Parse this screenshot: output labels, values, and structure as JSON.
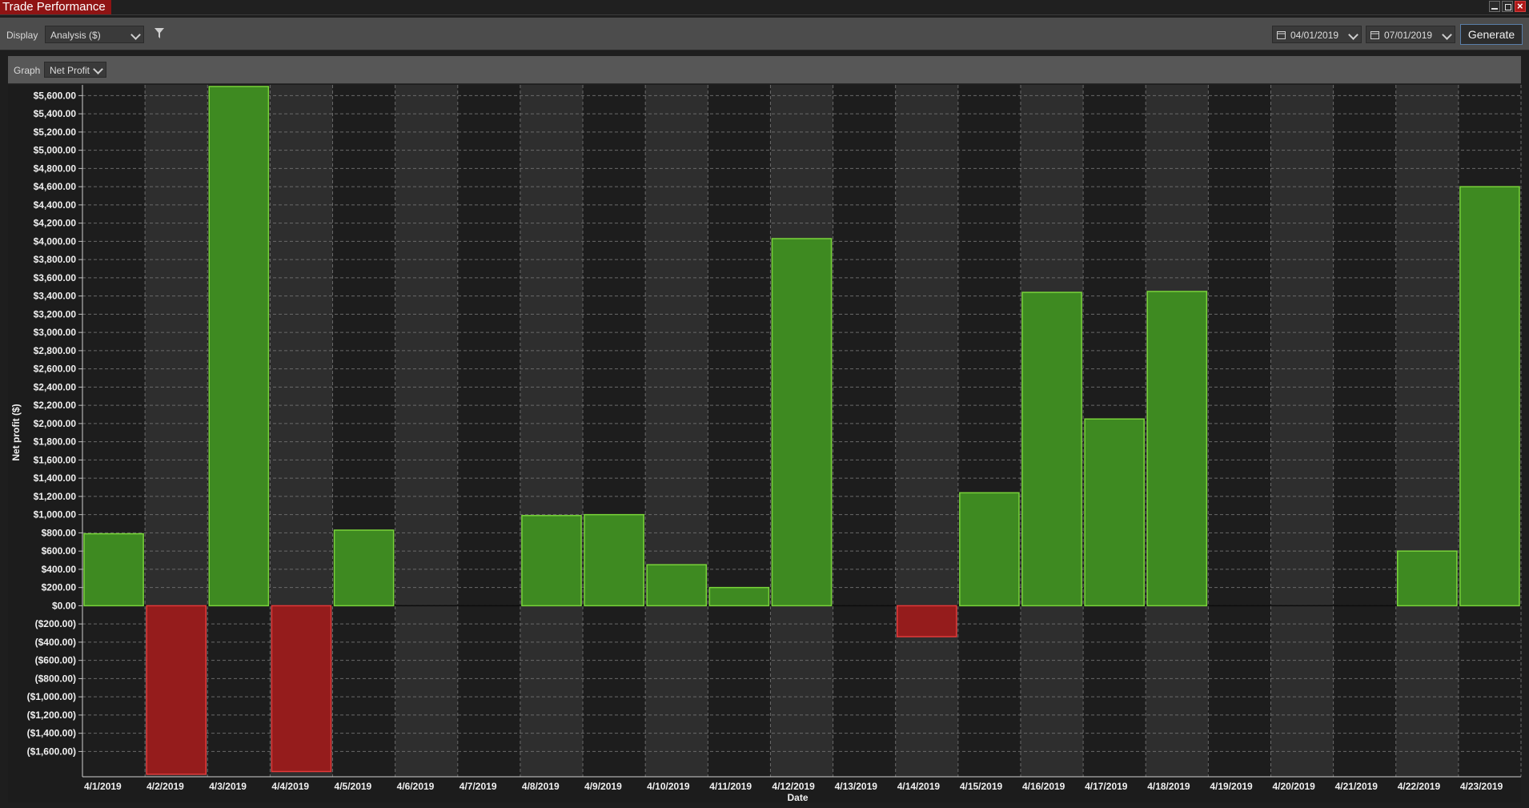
{
  "window": {
    "title": "Trade Performance"
  },
  "toolbar": {
    "display_label": "Display",
    "display_value": "Analysis ($)",
    "start_date": "04/01/2019",
    "end_date": "07/01/2019",
    "generate_label": "Generate"
  },
  "graphbar": {
    "graph_label": "Graph",
    "graph_value": "Net Profit"
  },
  "colors": {
    "positive_fill": "#3e8a21",
    "positive_stroke": "#79d33a",
    "negative_fill": "#951c1c",
    "negative_stroke": "#e23a3a",
    "band_dark": "#1d1d1d",
    "band_light": "#2e2e2e"
  },
  "chart_data": {
    "type": "bar",
    "xlabel": "Date",
    "ylabel": "Net profit ($)",
    "ylim": [
      -1860,
      5700
    ],
    "grid": true,
    "categories": [
      "4/1/2019",
      "4/2/2019",
      "4/3/2019",
      "4/4/2019",
      "4/5/2019",
      "4/6/2019",
      "4/7/2019",
      "4/8/2019",
      "4/9/2019",
      "4/10/2019",
      "4/11/2019",
      "4/12/2019",
      "4/13/2019",
      "4/14/2019",
      "4/15/2019",
      "4/16/2019",
      "4/17/2019",
      "4/18/2019",
      "4/19/2019",
      "4/20/2019",
      "4/21/2019",
      "4/22/2019",
      "4/23/2019"
    ],
    "values": [
      790,
      -1850,
      5700,
      -1820,
      830,
      0,
      0,
      990,
      1000,
      450,
      200,
      4030,
      0,
      -340,
      1240,
      3440,
      2050,
      3450,
      0,
      0,
      0,
      600,
      4600
    ],
    "yticks": [
      5600,
      5400,
      5200,
      5000,
      4800,
      4600,
      4400,
      4200,
      4000,
      3800,
      3600,
      3400,
      3200,
      3000,
      2800,
      2600,
      2400,
      2200,
      2000,
      1800,
      1600,
      1400,
      1200,
      1000,
      800,
      600,
      400,
      200,
      0,
      -200,
      -400,
      -600,
      -800,
      -1000,
      -1200,
      -1400,
      -1600
    ],
    "ytick_labels": [
      "$5,600.00",
      "$5,400.00",
      "$5,200.00",
      "$5,000.00",
      "$4,800.00",
      "$4,600.00",
      "$4,400.00",
      "$4,200.00",
      "$4,000.00",
      "$3,800.00",
      "$3,600.00",
      "$3,400.00",
      "$3,200.00",
      "$3,000.00",
      "$2,800.00",
      "$2,600.00",
      "$2,400.00",
      "$2,200.00",
      "$2,000.00",
      "$1,800.00",
      "$1,600.00",
      "$1,400.00",
      "$1,200.00",
      "$1,000.00",
      "$800.00",
      "$600.00",
      "$400.00",
      "$200.00",
      "$0.00",
      "($200.00)",
      "($400.00)",
      "($600.00)",
      "($800.00)",
      "($1,000.00)",
      "($1,200.00)",
      "($1,400.00)",
      "($1,600.00)"
    ]
  }
}
